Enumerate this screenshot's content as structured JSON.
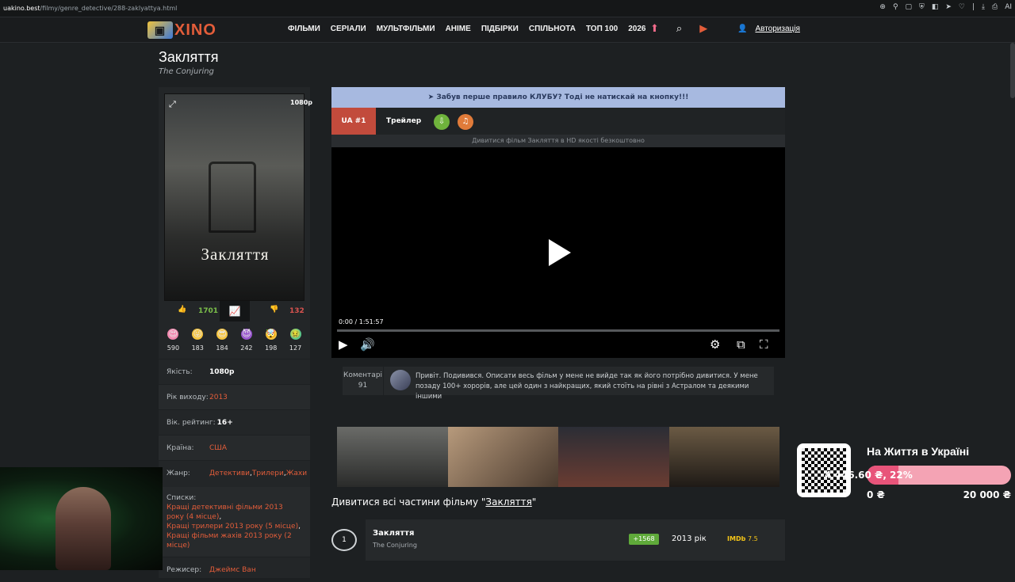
{
  "browser": {
    "host": "uakino.best",
    "path": "/filmy/genre_detective/288-zaklyattya.html",
    "tools_ai": "AI"
  },
  "nav": {
    "logo_text": "XINO",
    "links": [
      "ФІЛЬМИ",
      "СЕРІАЛИ",
      "МУЛЬТФІЛЬМИ",
      "АНІМЕ",
      "ПІДБІРКИ",
      "СПІЛЬНОТА",
      "ТОП 100",
      "2026"
    ],
    "auth_label": "Авторизація"
  },
  "movie": {
    "title": "Закляття",
    "original_title": "The Conjuring",
    "poster_title": "Закляття",
    "quality_badge": "1080p"
  },
  "votes": {
    "likes": "1701",
    "dislikes": "132"
  },
  "emoji_reactions": [
    {
      "icon": "heart-eyes-icon",
      "count": "590",
      "color": "#f28ab0"
    },
    {
      "icon": "tongue-face-icon",
      "count": "183",
      "color": "#f5c542"
    },
    {
      "icon": "cool-face-icon",
      "count": "184",
      "color": "#f5c542"
    },
    {
      "icon": "devil-face-icon",
      "count": "242",
      "color": "#9b59d0"
    },
    {
      "icon": "shocked-face-icon",
      "count": "198",
      "color": "#f5c542"
    },
    {
      "icon": "sick-face-icon",
      "count": "127",
      "color": "#5cc98a"
    }
  ],
  "info": {
    "quality_label": "Якість:",
    "quality_value": "1080p",
    "year_label": "Рік виходу:",
    "year_value": "2013",
    "age_label": "Вік. рейтинг:",
    "age_value": "16+",
    "country_label": "Країна:",
    "country_value": "США",
    "genre_label": "Жанр:",
    "genres": [
      "Детективи",
      "Трилери",
      "Жахи"
    ],
    "lists_label": "Списки:",
    "lists": [
      "Кращі детективні фільми 2013 року (4 місце)",
      "Кращі трилери 2013 року (5 місце)",
      "Кращі фільми жахів 2013 року (2 місце)"
    ],
    "director_label": "Режисер:",
    "director_value": "Джеймс Ван"
  },
  "player": {
    "banner_text": "Забув перше правило КЛУБУ? Тоді не натискай на кнопку!!!",
    "tab_ua": "UA #1",
    "tab_trailer": "Трейлер",
    "watch_line": "Дивитися фільм Закляття в HD якості безкоштовно",
    "time": "0:00 / 1:51:57"
  },
  "comments": {
    "label": "Коментарі",
    "count": "91",
    "text": "Привіт. Подивився. Описати весь фільм у мене не вийде так як його потрібно дивитися. У мене позаду 100+ хорорів, але цей один з найкращих, який стоїть на рівні з Астралом та деякими іншими"
  },
  "parts": {
    "heading_prefix": "Дивитися всі частини фільму \"",
    "heading_link": "Закляття",
    "heading_suffix": "\"",
    "rows": [
      {
        "num": "1",
        "title": "Закляття",
        "original": "The Conjuring",
        "score": "+1568",
        "year": "2013 рік",
        "imdb_label": "IMDb",
        "rating": "7.5"
      }
    ]
  },
  "donation": {
    "title": "На Життя в Україні",
    "bar_text": "4 446.60 ₴, 22%",
    "progress_percent": 22,
    "min": "0 ₴",
    "max": "20 000 ₴"
  },
  "colors": {
    "accent": "#e35d3a",
    "like": "#7bbf4a",
    "dislike": "#d9534f",
    "banner": "#a7b9e0",
    "donate_fill": "#e8547a"
  }
}
